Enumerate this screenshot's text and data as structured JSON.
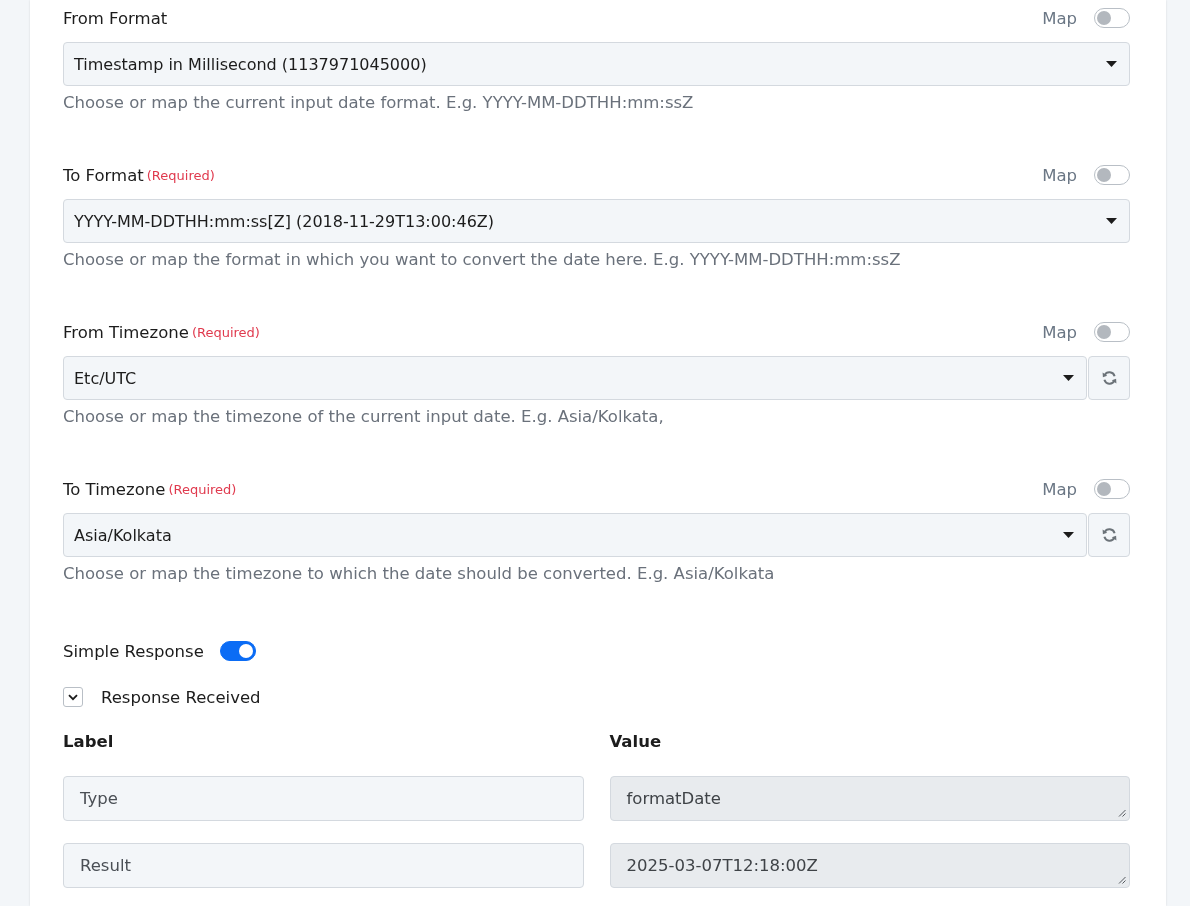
{
  "fields": [
    {
      "label": "From Format",
      "map": {
        "label": "Map",
        "on": false
      },
      "value": "Timestamp in Millisecond (1137971045000)",
      "refresh_button": false,
      "hint": "Choose or map the current input date format. E.g. YYYY-MM-DDTHH:mm:ssZ"
    },
    {
      "label": "To Format",
      "note": "(Required)",
      "map": {
        "label": "Map",
        "on": false
      },
      "value": "YYYY-MM-DDTHH:mm:ss[Z] (2018-11-29T13:00:46Z)",
      "refresh_button": false,
      "hint": "Choose or map the format in which you want to convert the date here. E.g. YYYY-MM-DDTHH:mm:ssZ"
    },
    {
      "label": "From Timezone",
      "note": "(Required)",
      "map": {
        "label": "Map",
        "on": false
      },
      "value": "Etc/UTC",
      "refresh_button": true,
      "hint": "Choose or map the timezone of the current input date. E.g. Asia/Kolkata,"
    },
    {
      "label": "To Timezone",
      "note": "(Required)",
      "map": {
        "label": "Map",
        "on": false
      },
      "value": "Asia/Kolkata",
      "refresh_button": true,
      "hint": "Choose or map the timezone to which the date should be converted. E.g. Asia/Kolkata"
    }
  ],
  "simple_response": {
    "label": "Simple Response",
    "on": true
  },
  "response": {
    "title": "Response Received",
    "expanded": true,
    "columns": [
      "Label",
      "Value"
    ],
    "rows": [
      {
        "label": "Type",
        "value": "formatDate"
      },
      {
        "label": "Result",
        "value": "2025-03-07T12:18:00Z"
      }
    ]
  }
}
